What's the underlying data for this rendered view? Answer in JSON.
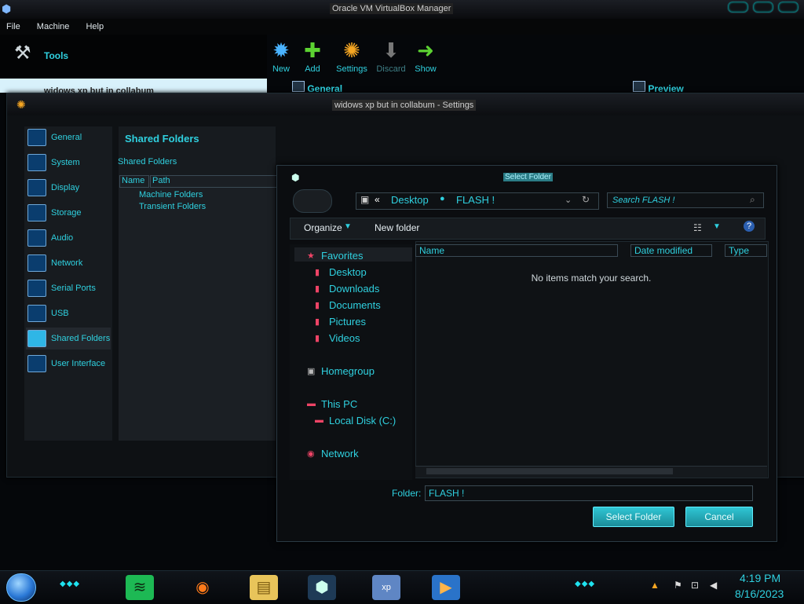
{
  "main": {
    "title": "Oracle VM VirtualBox Manager",
    "menus": [
      "File",
      "Machine",
      "Help"
    ],
    "tools_label": "Tools",
    "toolbar": {
      "new": "New",
      "add": "Add",
      "settings": "Settings",
      "discard": "Discard",
      "show": "Show"
    },
    "vm_name": "widows xp but in collabum",
    "general_header": "General",
    "preview_header": "Preview"
  },
  "settings": {
    "title": "widows xp but in collabum - Settings",
    "categories": [
      "General",
      "System",
      "Display",
      "Storage",
      "Audio",
      "Network",
      "Serial Ports",
      "USB",
      "Shared Folders",
      "User Interface"
    ],
    "selected": "Shared Folders",
    "panel_title": "Shared Folders",
    "panel_label": "Shared Folders",
    "col_name": "Name",
    "col_path": "Path",
    "row_machine": "Machine Folders",
    "row_transient": "Transient Folders"
  },
  "dialog": {
    "title": "Select Folder",
    "address": {
      "sep": "«",
      "seg1": "Desktop",
      "seg2": "FLASH !"
    },
    "search_placeholder": "Search FLASH !",
    "organize": "Organize",
    "new_folder": "New folder",
    "help": "?",
    "nav": {
      "favorites": "Favorites",
      "desktop": "Desktop",
      "downloads": "Downloads",
      "documents": "Documents",
      "pictures": "Pictures",
      "videos": "Videos",
      "homegroup": "Homegroup",
      "this_pc": "This PC",
      "local_disk": "Local Disk (C:)",
      "network": "Network"
    },
    "columns": {
      "name": "Name",
      "date_modified": "Date modified",
      "type": "Type"
    },
    "empty_message": "No items match your search.",
    "folder_label": "Folder:",
    "folder_value": "FLASH !",
    "select_button": "Select Folder",
    "cancel_button": "Cancel"
  },
  "taskbar": {
    "time": "4:19 PM",
    "date": "8/16/2023",
    "xp_badge": "xp"
  },
  "colors": {
    "accent": "#2fd0df",
    "background": "#05070a",
    "button": "#2fc6d4"
  }
}
